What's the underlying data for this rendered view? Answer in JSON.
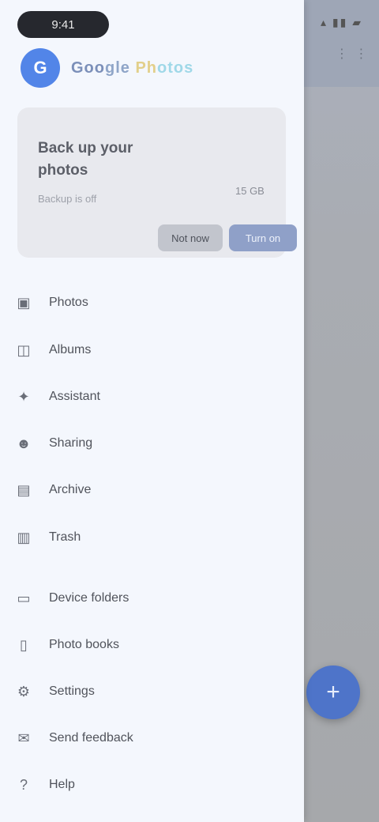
{
  "status_bar": {
    "time": "9:41",
    "icons": "▴ ▮▮ ▰"
  },
  "app": {
    "logo_letter": "G",
    "logo_segments": [
      "Goo",
      "gle",
      " Ph",
      "otos"
    ]
  },
  "promo": {
    "title": "Back up your photos",
    "subtitle": "Backup is off",
    "badge": "15 GB",
    "secondary_label": "Not now",
    "primary_label": "Turn on"
  },
  "menu": {
    "items": [
      {
        "label": "Photos",
        "icon": "photo-icon",
        "glyph": "▣"
      },
      {
        "label": "Albums",
        "icon": "album-icon",
        "glyph": "◫"
      },
      {
        "label": "Assistant",
        "icon": "assistant-icon",
        "glyph": "✦"
      },
      {
        "label": "Sharing",
        "icon": "people-icon",
        "glyph": "☻"
      },
      {
        "label": "Archive",
        "icon": "archive-icon",
        "glyph": "▤"
      },
      {
        "label": "Trash",
        "icon": "trash-icon",
        "glyph": "▥"
      },
      {
        "label": "Device folders",
        "icon": "folder-icon",
        "glyph": "▭"
      },
      {
        "label": "Photo books",
        "icon": "book-icon",
        "glyph": "▯"
      },
      {
        "label": "Settings",
        "icon": "gear-icon",
        "glyph": "⚙"
      },
      {
        "label": "Send feedback",
        "icon": "feedback-icon",
        "glyph": "✉"
      },
      {
        "label": "Help",
        "icon": "help-icon",
        "glyph": "?"
      }
    ]
  },
  "fab": {
    "glyph": "+"
  },
  "scrim": {
    "menu_glyph": "⋮ ⋮"
  }
}
